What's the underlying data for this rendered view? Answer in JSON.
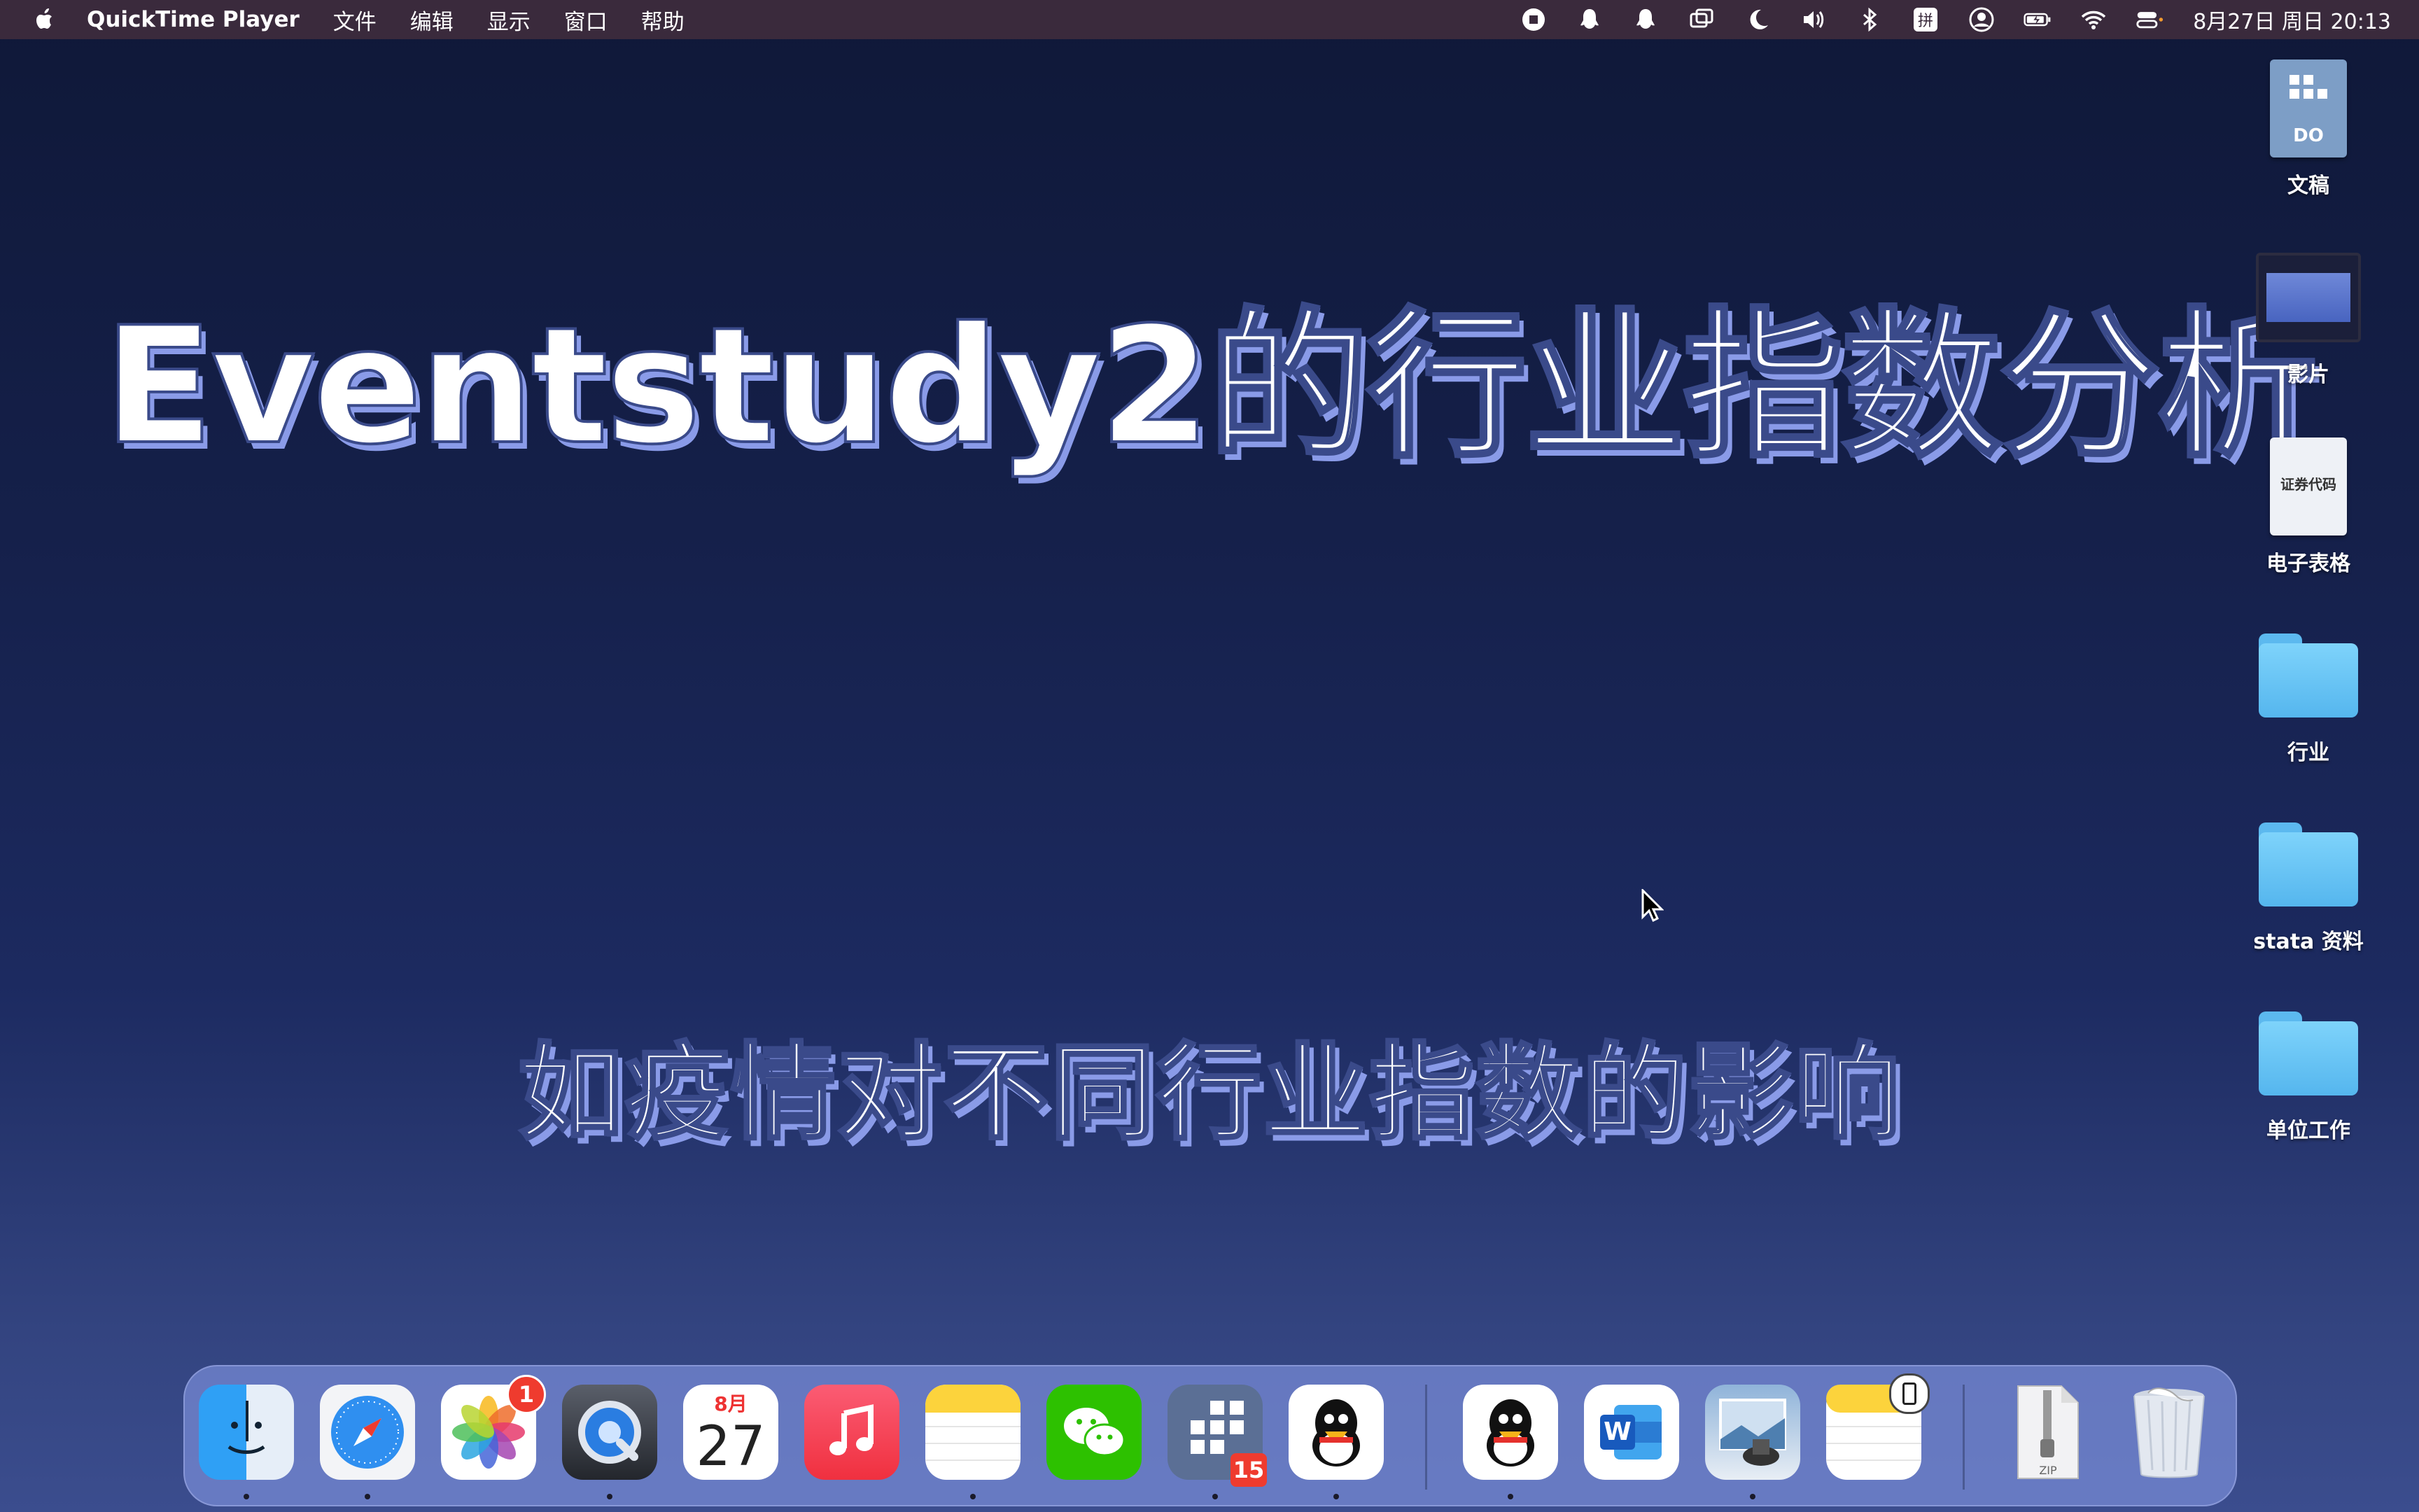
{
  "menubar": {
    "app_name": "QuickTime Player",
    "menus": [
      "文件",
      "编辑",
      "显示",
      "窗口",
      "帮助"
    ],
    "clock": "8月27日 周日 20:13"
  },
  "video": {
    "title": "Eventstudy2的行业指数分析",
    "subtitle": "如疫情对不同行业指数的影响"
  },
  "desktop_icons": [
    {
      "label": "文稿",
      "kind": "document",
      "icon_text": "DO"
    },
    {
      "label": "影片",
      "kind": "movie"
    },
    {
      "label": "电子表格",
      "kind": "spreadsheet",
      "icon_text": "证券代码"
    },
    {
      "label": "行业",
      "kind": "folder"
    },
    {
      "label": "stata 资料",
      "kind": "folder"
    },
    {
      "label": "单位工作",
      "kind": "folder"
    }
  ],
  "dock": {
    "apps": [
      {
        "name": "finder-icon"
      },
      {
        "name": "safari-icon"
      },
      {
        "name": "photos-icon",
        "badge": "1"
      },
      {
        "name": "quicktime-icon"
      },
      {
        "name": "calendar-icon",
        "month": "8月",
        "day": "27"
      },
      {
        "name": "music-icon"
      },
      {
        "name": "notes-icon"
      },
      {
        "name": "wechat-icon"
      },
      {
        "name": "stata-grid-icon",
        "badge": "15"
      },
      {
        "name": "qq-icon"
      },
      {
        "name": "qq-icon-2"
      },
      {
        "name": "word-icon",
        "letter": "W"
      },
      {
        "name": "preview-icon"
      },
      {
        "name": "notes-phone-icon"
      },
      {
        "name": "zip-archive-icon",
        "label": "ZIP"
      },
      {
        "name": "trash-icon"
      }
    ]
  },
  "colors": {
    "menubar_bg": "#3a2a3c",
    "title_shadow": "#8a9be8",
    "folder": "#6cc6f6"
  }
}
